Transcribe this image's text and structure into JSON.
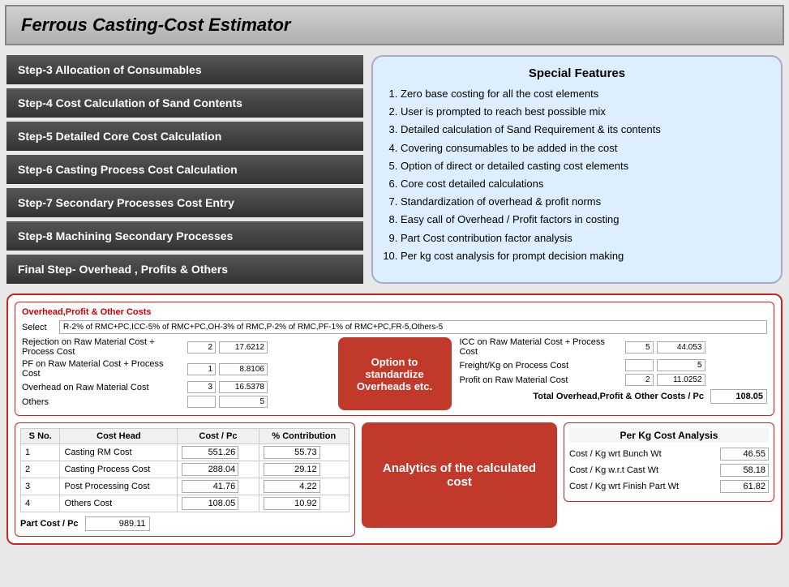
{
  "header": {
    "title": "Ferrous Casting-Cost Estimator"
  },
  "steps": [
    {
      "id": "step3",
      "label": "Step-3  Allocation of Consumables"
    },
    {
      "id": "step4",
      "label": "Step-4  Cost Calculation of Sand Contents"
    },
    {
      "id": "step5",
      "label": "Step-5  Detailed Core Cost Calculation"
    },
    {
      "id": "step6",
      "label": "Step-6  Casting Process Cost Calculation"
    },
    {
      "id": "step7",
      "label": "Step-7  Secondary Processes Cost Entry"
    },
    {
      "id": "step8",
      "label": "Step-8  Machining Secondary Processes"
    },
    {
      "id": "final",
      "label": "Final Step-  Overhead , Profits & Others"
    }
  ],
  "features": {
    "title": "Special Features",
    "items": [
      "Zero base costing for all the cost elements",
      "User is prompted to reach best possible mix",
      "Detailed calculation of Sand Requirement & its contents",
      "Covering consumables to be added in the cost",
      "Option of direct or detailed  casting cost elements",
      "Core cost detailed calculations",
      "Standardization of overhead & profit norms",
      "Easy call of Overhead / Profit factors in costing",
      "Part Cost contribution factor analysis",
      "Per kg cost analysis for prompt decision making"
    ]
  },
  "overhead": {
    "panel_title": "Overhead,Profit & Other Costs",
    "select_label": "Select",
    "select_value": "R-2% of RMC+PC,ICC-5% of RMC+PC,OH-3% of RMC,P-2% of RMC,PF-1% of RMC+PC,FR-5,Others-5",
    "rows": [
      {
        "label": "Rejection on Raw Material Cost + Process Cost",
        "val1": "2",
        "val2": "17.6212"
      },
      {
        "label": "PF on Raw Material Cost + Process Cost",
        "val1": "1",
        "val2": "8.8106"
      },
      {
        "label": "Overhead on Raw Material Cost",
        "val1": "3",
        "val2": "16.5378"
      },
      {
        "label": "Others",
        "val1": "",
        "val2": "5"
      }
    ],
    "right_rows": [
      {
        "label": "ICC on Raw Material Cost + Process Cost",
        "val1": "5",
        "val2": "44.053"
      },
      {
        "label": "Freight/Kg on Process Cost",
        "val1": "",
        "val2": "5"
      },
      {
        "label": "Profit on Raw Material Cost",
        "val1": "2",
        "val2": "11.0252"
      }
    ],
    "total_label": "Total Overhead,Profit & Other Costs / Pc",
    "total_value": "108.05",
    "option_box_text": "Option to standardize Overheads etc."
  },
  "cost_table": {
    "columns": [
      "S No.",
      "Cost Head",
      "Cost / Pc",
      "% Contribution"
    ],
    "rows": [
      {
        "sno": "1",
        "head": "Casting RM Cost",
        "cost": "551.26",
        "pct": "55.73"
      },
      {
        "sno": "2",
        "head": "Casting Process Cost",
        "cost": "288.04",
        "pct": "29.12"
      },
      {
        "sno": "3",
        "head": "Post Processing Cost",
        "cost": "41.76",
        "pct": "4.22"
      },
      {
        "sno": "4",
        "head": "Others Cost",
        "cost": "108.05",
        "pct": "10.92"
      }
    ],
    "part_cost_label": "Part Cost / Pc",
    "part_cost_value": "989.11"
  },
  "analytics_box": {
    "text": "Analytics of the calculated cost"
  },
  "perkg": {
    "title": "Per Kg Cost Analysis",
    "rows": [
      {
        "label": "Cost / Kg  wrt  Bunch Wt",
        "value": "46.55"
      },
      {
        "label": "Cost / Kg  w.r.t  Cast Wt",
        "value": "58.18"
      },
      {
        "label": "Cost / Kg  wrt  Finish Part Wt",
        "value": "61.82"
      }
    ]
  }
}
